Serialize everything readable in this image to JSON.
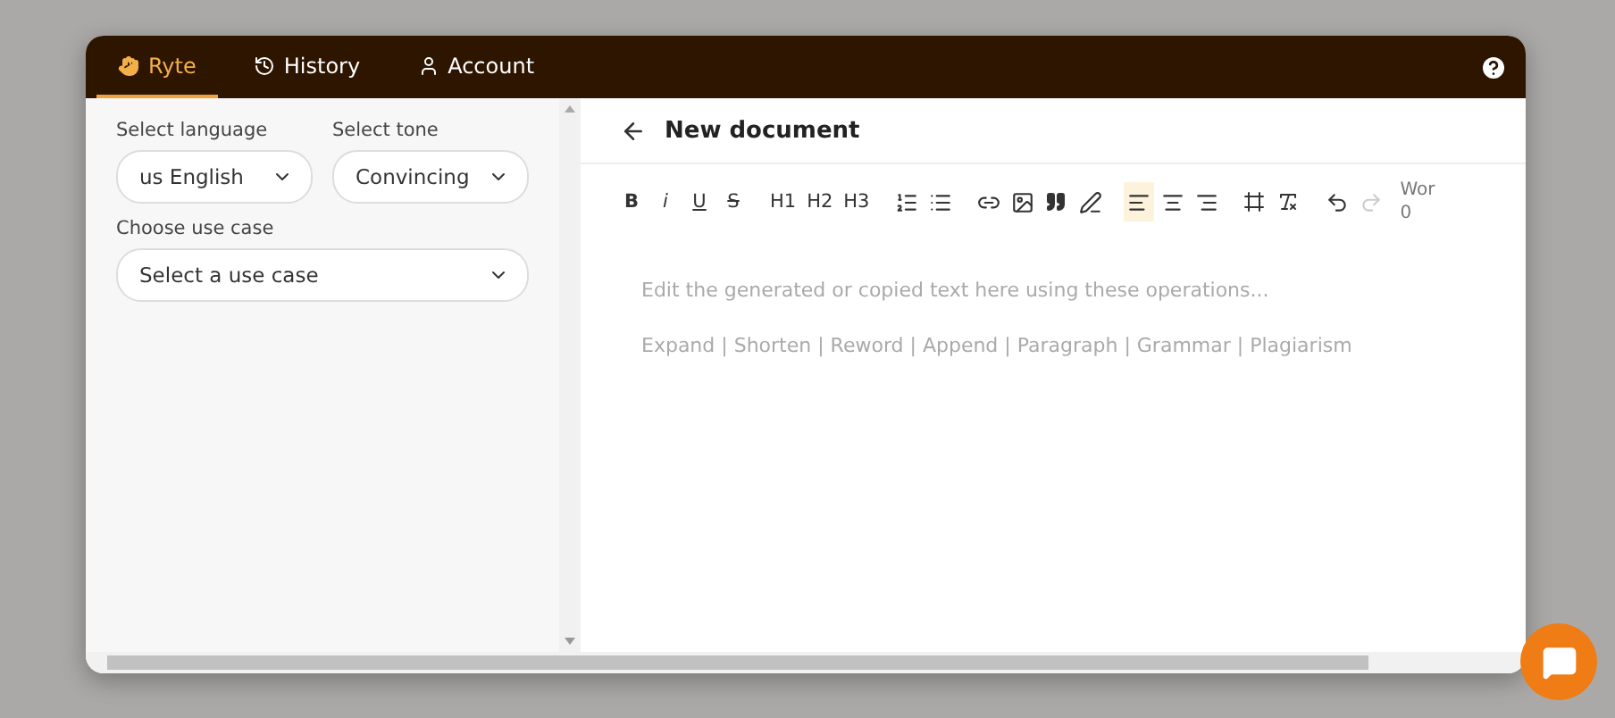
{
  "tabs": [
    {
      "label": "Ryte",
      "selected": true
    },
    {
      "label": "History",
      "selected": false
    },
    {
      "label": "Account",
      "selected": false
    }
  ],
  "settings": {
    "language": {
      "label": "Select language",
      "value": "us English"
    },
    "tone": {
      "label": "Select tone",
      "value": "Convincing"
    },
    "use_case": {
      "label": "Choose use case",
      "placeholder": "Select a use case"
    }
  },
  "document": {
    "title": "New document"
  },
  "toolbar": {
    "format_buttons": [
      {
        "label": "B"
      },
      {
        "label": "i"
      },
      {
        "label": "U"
      },
      {
        "label": "S"
      }
    ],
    "heading_buttons": [
      "H1",
      "H2",
      "H3"
    ],
    "align_buttons": [
      {
        "selected": true
      },
      {
        "selected": false
      },
      {
        "selected": false
      }
    ],
    "history_buttons": [
      {
        "disabled": false
      },
      {
        "disabled": true
      }
    ],
    "word_count": {
      "label": "Wor",
      "value": "0"
    }
  },
  "editor": {
    "placeholder": "Edit the generated or copied text here using these operations...",
    "operations": "Expand | Shorten | Reword | Append | Paragraph | Grammar | Plagiarism"
  }
}
